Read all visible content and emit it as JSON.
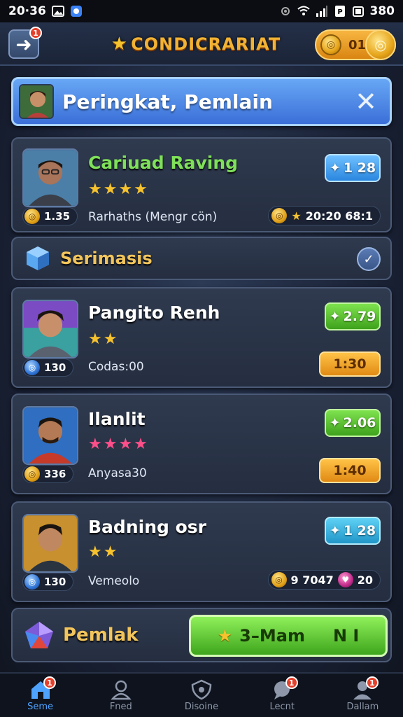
{
  "status_bar": {
    "time": "20·36",
    "battery": "380"
  },
  "top_bar": {
    "title": "CONDICRARIAT",
    "coin_count": "01",
    "back_badge": "1"
  },
  "header": {
    "title": "Peringkat, Pemlain"
  },
  "players": [
    {
      "name": "Cariuad Raving",
      "stars": "★★★★",
      "badge_value": "1.35",
      "sub": "Rarhaths (Mengr cön)",
      "score": "1 28",
      "stat": "20:20 68:1"
    },
    {
      "name": "Pangito Renh",
      "stars": "★★",
      "badge_value": "130",
      "sub": "Codas:00",
      "score": "2.79",
      "time": "1:30"
    },
    {
      "name": "Ilanlit",
      "stars": "★★★★",
      "badge_value": "336",
      "sub": "Anyasa30",
      "score": "2.06",
      "time": "1:40"
    },
    {
      "name": "Badning osr",
      "stars": "★★",
      "badge_value": "130",
      "sub": "Vemeolo",
      "score": "1 28",
      "stat_a": "9 7047",
      "stat_b": "20"
    }
  ],
  "section": {
    "label": "Serimasis"
  },
  "bottom": {
    "label": "Pemlak",
    "button_label": "3–Mam",
    "button_suffix": "N I"
  },
  "tabs": [
    {
      "label": "Seme",
      "icon": "home-icon",
      "badge": "1"
    },
    {
      "label": "Fned",
      "icon": "person-icon",
      "badge": ""
    },
    {
      "label": "Disoine",
      "icon": "shield-icon",
      "badge": ""
    },
    {
      "label": "Lecnt",
      "icon": "chat-icon",
      "badge": "1"
    },
    {
      "label": "Dallam",
      "icon": "profile-icon",
      "badge": "1"
    }
  ],
  "colors": {
    "accent": "#3b6fd8",
    "gold": "#f2b233",
    "green": "#3ea21c"
  }
}
